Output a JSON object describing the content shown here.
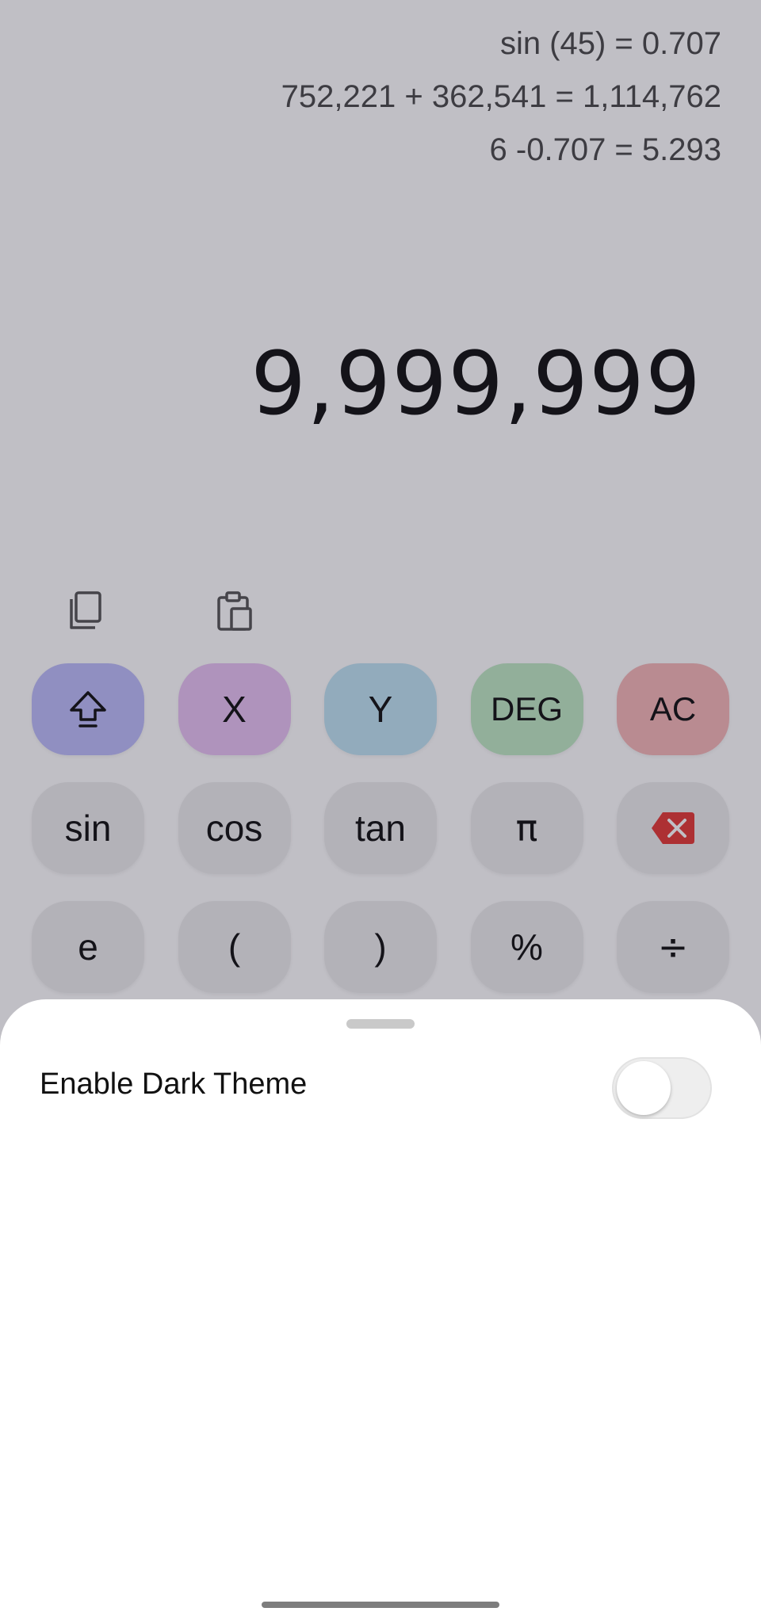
{
  "history": [
    "sin (45) = 0.707",
    "752,221 + 362,541 = 1,114,762",
    "6 -0.707 = 5.293"
  ],
  "display": {
    "value": "9,999,999"
  },
  "tools": {
    "copy_icon": "copy-icon",
    "paste_icon": "paste-icon"
  },
  "keypad": {
    "row1": [
      {
        "label": "",
        "icon": "shift-icon",
        "color": "#bdbdfa"
      },
      {
        "label": "X",
        "color": "#e8c3f3"
      },
      {
        "label": "Y",
        "color": "#bfe3f3"
      },
      {
        "label": "DEG",
        "color": "#bfe9c4"
      },
      {
        "label": "AC",
        "color": "#f6b8b8"
      }
    ],
    "row2": [
      {
        "label": "sin"
      },
      {
        "label": "cos"
      },
      {
        "label": "tan"
      },
      {
        "label": "π"
      },
      {
        "label": "",
        "icon": "backspace-icon",
        "color": "#e53935"
      }
    ],
    "row3": [
      {
        "label": "e"
      },
      {
        "label": "("
      },
      {
        "label": ")"
      },
      {
        "label": "%"
      },
      {
        "label": "÷"
      }
    ]
  },
  "settings_sheet": {
    "dark_theme_label": "Enable Dark Theme",
    "dark_theme_enabled": false
  }
}
